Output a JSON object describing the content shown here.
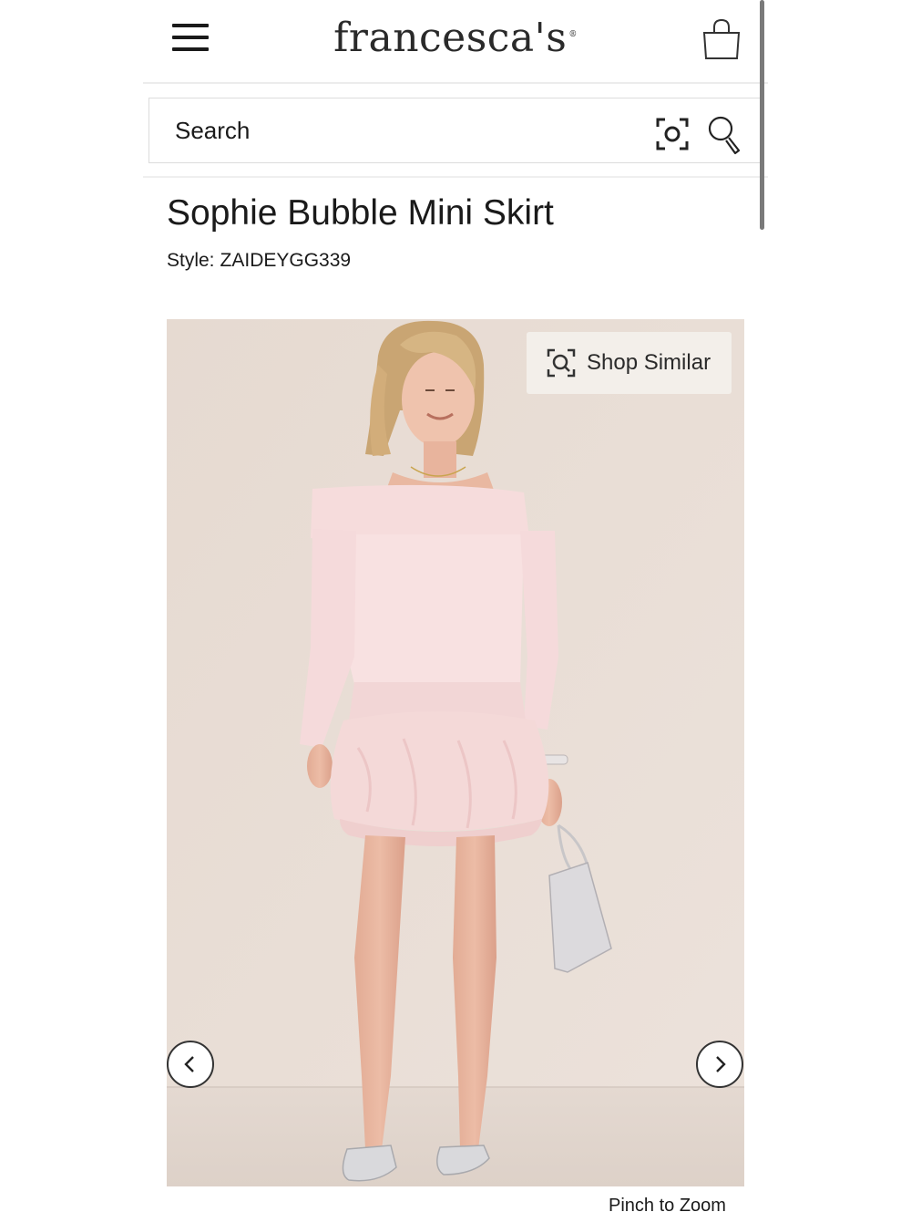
{
  "header": {
    "logo_text": "francesca's",
    "logo_mark": "®",
    "menu_icon": "hamburger-menu-icon",
    "bag_icon": "shopping-bag-icon"
  },
  "search": {
    "placeholder": "Search",
    "visual_search_icon": "camera-scan-icon",
    "search_icon": "magnifier-icon"
  },
  "product": {
    "title": "Sophie Bubble Mini Skirt",
    "style_label": "Style:",
    "style_code": "ZAIDEYGG339"
  },
  "gallery": {
    "shop_similar_label": "Shop Similar",
    "shop_similar_icon": "visual-search-icon",
    "prev_icon": "chevron-left-icon",
    "next_icon": "chevron-right-icon",
    "pinch_hint": "Pinch to Zoom"
  },
  "colors": {
    "background": "#ffffff",
    "photo_backdrop": "#e9dfd7",
    "text": "#1a1a1a",
    "skirt_pink": "#f4d9d8"
  }
}
